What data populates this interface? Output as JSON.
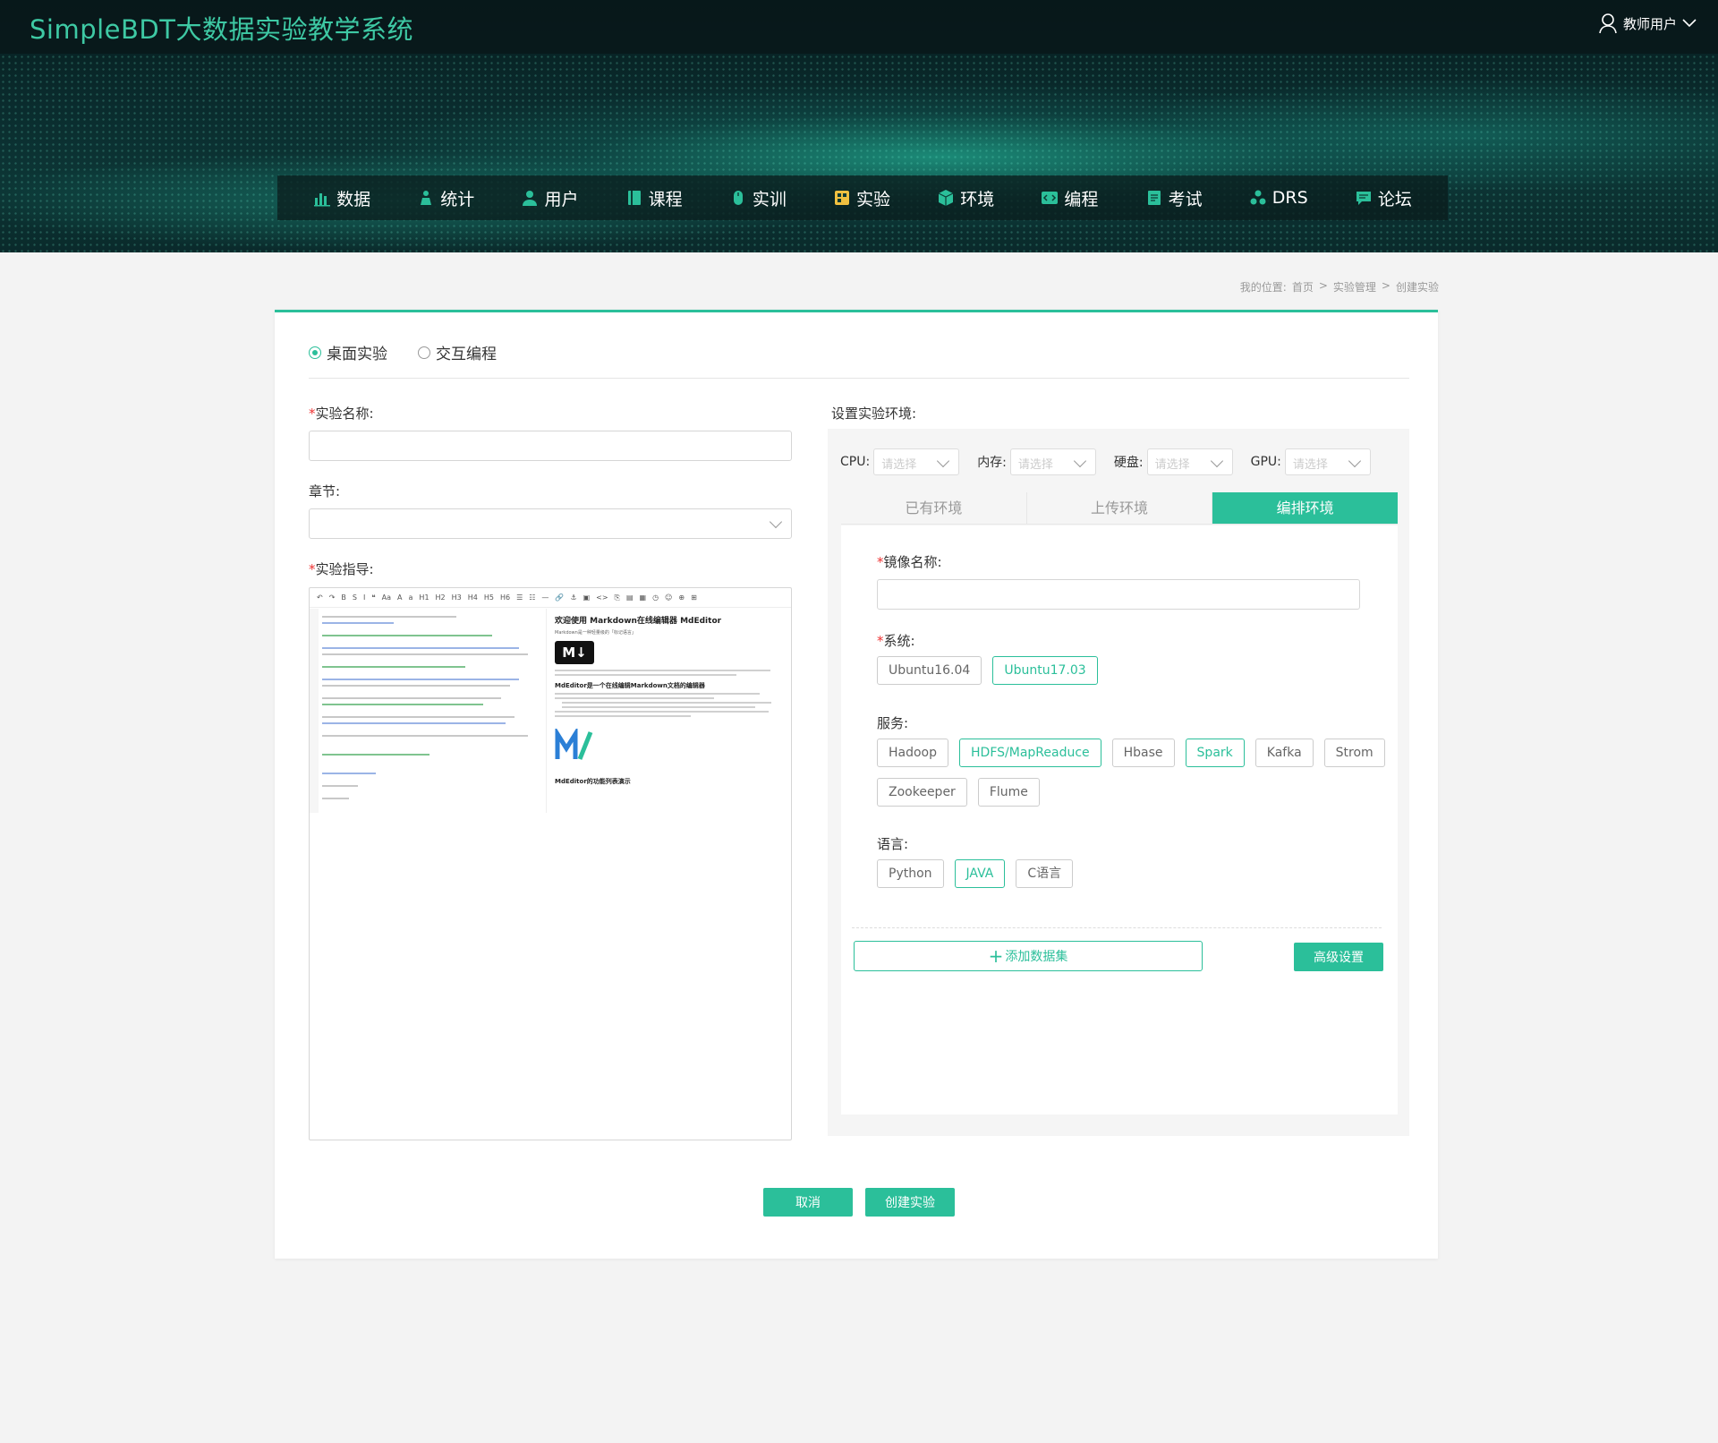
{
  "app": {
    "title": "SimpleBDT大数据实验教学系统",
    "user_label": "教师用户"
  },
  "nav": [
    {
      "label": "数据",
      "icon": "bar-chart-icon"
    },
    {
      "label": "统计",
      "icon": "presenter-icon"
    },
    {
      "label": "用户",
      "icon": "user-icon"
    },
    {
      "label": "课程",
      "icon": "book-icon"
    },
    {
      "label": "实训",
      "icon": "mouse-icon"
    },
    {
      "label": "实验",
      "icon": "experiment-icon"
    },
    {
      "label": "环境",
      "icon": "cube-icon"
    },
    {
      "label": "编程",
      "icon": "code-icon"
    },
    {
      "label": "考试",
      "icon": "exam-icon"
    },
    {
      "label": "DRS",
      "icon": "cluster-icon"
    },
    {
      "label": "论坛",
      "icon": "chat-icon"
    }
  ],
  "breadcrumb": {
    "prefix": "我的位置:",
    "items": [
      "首页",
      "实验管理",
      "创建实验"
    ]
  },
  "mode": {
    "options": [
      "桌面实验",
      "交互编程"
    ],
    "selected": "桌面实验"
  },
  "form": {
    "name_label": "实验名称:",
    "name_value": "",
    "chapter_label": "章节:",
    "chapter_value": "",
    "guide_label": "实验指导:"
  },
  "editor": {
    "toolbar": [
      "↶",
      "↷",
      "B",
      "S",
      "I",
      "❝",
      "Aa",
      "A",
      "a",
      "H1",
      "H2",
      "H3",
      "H4",
      "H5",
      "H6",
      "☰",
      "☷",
      "—",
      "🔗",
      "⚓",
      "▣",
      "<>",
      "⎘",
      "▤",
      "▦",
      "◷",
      "☺",
      "⊕",
      "⊞"
    ],
    "preview_title": "欢迎使用 Markdown在线编辑器 MdEditor",
    "preview_sub": "Markdown是一种轻量级的「标记语言」",
    "md_logo": "M↓",
    "preview_h2": "MdEditor是一个在线编辑Markdown文档的编辑器",
    "preview_footer": "MdEditor的功能列表演示"
  },
  "env": {
    "label": "设置实验环境:",
    "selects": [
      {
        "label": "CPU:",
        "placeholder": "请选择"
      },
      {
        "label": "内存:",
        "placeholder": "请选择"
      },
      {
        "label": "硬盘:",
        "placeholder": "请选择"
      },
      {
        "label": "GPU:",
        "placeholder": "请选择"
      }
    ],
    "tabs": [
      "已有环境",
      "上传环境",
      "编排环境"
    ],
    "active_tab": "编排环境",
    "image_label": "镜像名称:",
    "image_value": "",
    "system_label": "系统:",
    "systems": [
      {
        "label": "Ubuntu16.04",
        "on": false
      },
      {
        "label": "Ubuntu17.03",
        "on": true
      }
    ],
    "service_label": "服务:",
    "services": [
      {
        "label": "Hadoop",
        "on": false
      },
      {
        "label": "HDFS/MapReaduce",
        "on": true
      },
      {
        "label": "Hbase",
        "on": false
      },
      {
        "label": "Spark",
        "on": true
      },
      {
        "label": "Kafka",
        "on": false
      },
      {
        "label": "Strom",
        "on": false
      },
      {
        "label": "Zookeeper",
        "on": false
      },
      {
        "label": "Flume",
        "on": false
      }
    ],
    "language_label": "语言:",
    "languages": [
      {
        "label": "Python",
        "on": false
      },
      {
        "label": "JAVA",
        "on": true
      },
      {
        "label": "C语言",
        "on": false
      }
    ],
    "add_dataset": "添加数据集",
    "advanced": "高级设置"
  },
  "actions": {
    "cancel": "取消",
    "create": "创建实验"
  },
  "colors": {
    "accent": "#2bbf9a",
    "header_bg": "#0a2b2d",
    "title": "#3ec9a4"
  }
}
